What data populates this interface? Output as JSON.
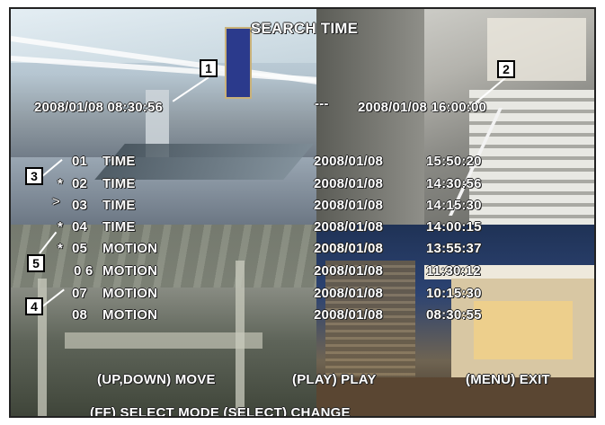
{
  "title": "SEARCH  TIME",
  "range": {
    "start": "2008/01/08  08:30:56",
    "separator": "---",
    "end": "2008/01/08  16:00:00"
  },
  "records": [
    {
      "marker": "",
      "index": "01",
      "event": "TIME",
      "date": "2008/01/08",
      "time": "15:50:20"
    },
    {
      "marker": "*",
      "index": "02",
      "event": "TIME",
      "date": "2008/01/08",
      "time": "14:30:56"
    },
    {
      "marker": ">",
      "index": "03",
      "event": "TIME",
      "date": "2008/01/08",
      "time": "14:15:30"
    },
    {
      "marker": "*",
      "index": "04",
      "event": "TIME",
      "date": "2008/01/08",
      "time": "14:00:15"
    },
    {
      "marker": "*",
      "index": "05",
      "event": "MOTION",
      "date": "2008/01/08",
      "time": "13:55:37"
    },
    {
      "marker": "",
      "index": "0 6",
      "event": "MOTION",
      "date": "2008/01/08",
      "time": "11:30:12"
    },
    {
      "marker": "",
      "index": "07",
      "event": "MOTION",
      "date": "2008/01/08",
      "time": "10:15:30"
    },
    {
      "marker": "",
      "index": "08",
      "event": "MOTION",
      "date": "2008/01/08",
      "time": "08:30:55"
    }
  ],
  "help": {
    "move": "(UP,DOWN) MOVE",
    "play": "(PLAY) PLAY",
    "exit": "(MENU) EXIT",
    "select_mode": "(FF) SELECT MODE  (SELECT) CHANGE"
  },
  "callouts": [
    "1",
    "2",
    "3",
    "4",
    "5"
  ]
}
